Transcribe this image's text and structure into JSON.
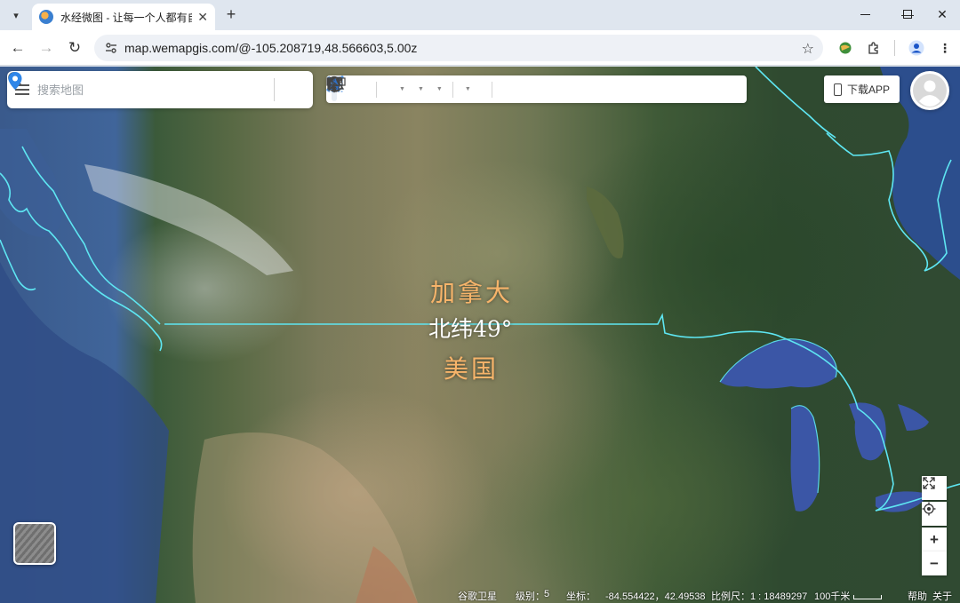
{
  "browser": {
    "tab_title": "水经微图 - 让每一个人都有自己",
    "url": "map.wemapgis.com/@-105.208719,48.566603,5.00z"
  },
  "search": {
    "placeholder": "搜索地图"
  },
  "toolbar": {
    "tools": [
      "hand-tool",
      "pointer-tool",
      "box-select-tool",
      "zoom-box-tool",
      "marker-tool",
      "polyline-tool",
      "polygon-tool",
      "text-tool",
      "measure-tool",
      "identify-tool",
      "globe-tool"
    ]
  },
  "header": {
    "download_label": "下载APP"
  },
  "map": {
    "label_canada": "加拿大",
    "label_latitude": "北纬49°",
    "label_usa": "美国",
    "border_color": "#5ee6f2",
    "label_color": "#f7b46a"
  },
  "status": {
    "layer": "谷歌卫星",
    "zoom_label": "级别：",
    "zoom_value": "5",
    "coord_label": "坐标：",
    "coords": "-84.554422，42.49538",
    "scale_label": "比例尺：1 : 18489297",
    "scale_bar_label": "100千米",
    "help": "帮助",
    "about": "关于"
  }
}
